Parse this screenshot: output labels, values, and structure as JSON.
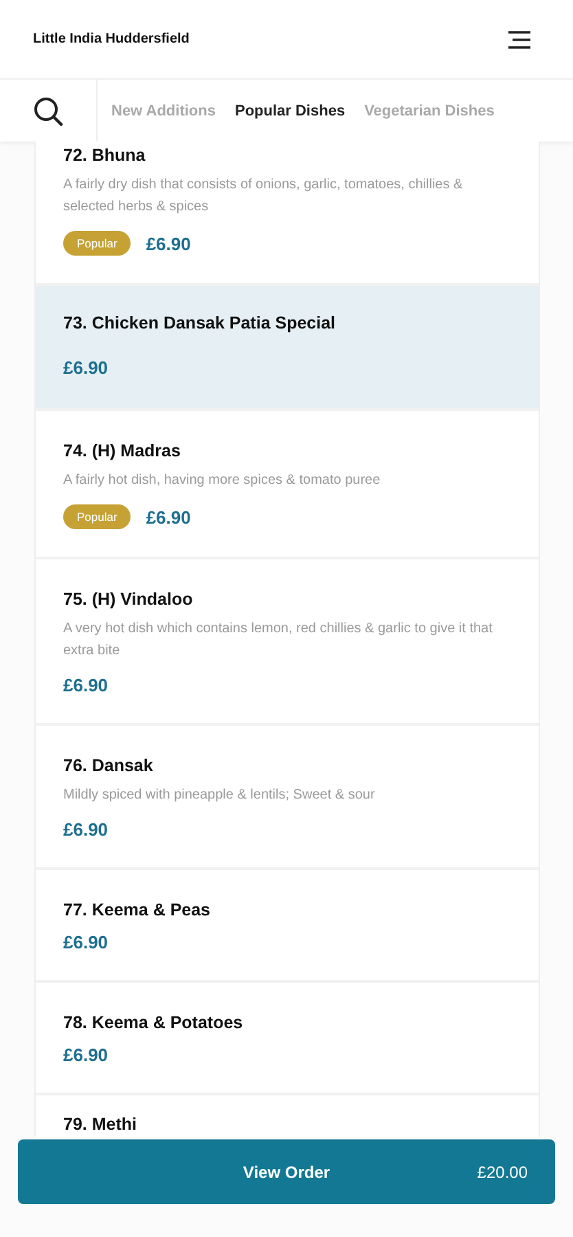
{
  "header": {
    "title": "Little India Huddersfield"
  },
  "tabs": [
    {
      "label": "New Additions",
      "selected": false
    },
    {
      "label": "Popular Dishes",
      "selected": true
    },
    {
      "label": "Vegetarian Dishes",
      "selected": false
    }
  ],
  "dishes": [
    {
      "name": "72. Bhuna",
      "description": "A fairly dry dish that consists of onions, garlic, tomatoes, chillies & selected herbs & spices",
      "badge": "Popular",
      "price": "£6.90",
      "selected": false
    },
    {
      "name": "73. Chicken Dansak Patia Special",
      "price": "£6.90",
      "selected": true
    },
    {
      "name": "74. (H) Madras",
      "description": "A fairly hot dish, having more spices & tomato puree",
      "badge": "Popular",
      "price": "£6.90",
      "selected": false
    },
    {
      "name": "75. (H) Vindaloo",
      "description": "A very hot dish which contains lemon, red chillies & garlic to give it that extra bite",
      "price": "£6.90",
      "selected": false
    },
    {
      "name": "76. Dansak",
      "description": "Mildly spiced with pineapple & lentils; Sweet & sour",
      "price": "£6.90",
      "selected": false
    },
    {
      "name": "77. Keema & Peas",
      "price": "£6.90",
      "selected": false
    },
    {
      "name": "78. Keema & Potatoes",
      "price": "£6.90",
      "selected": false
    },
    {
      "name": "79. Methi",
      "selected": false
    }
  ],
  "order_button": {
    "label": "View Order",
    "total": "£20.00"
  }
}
